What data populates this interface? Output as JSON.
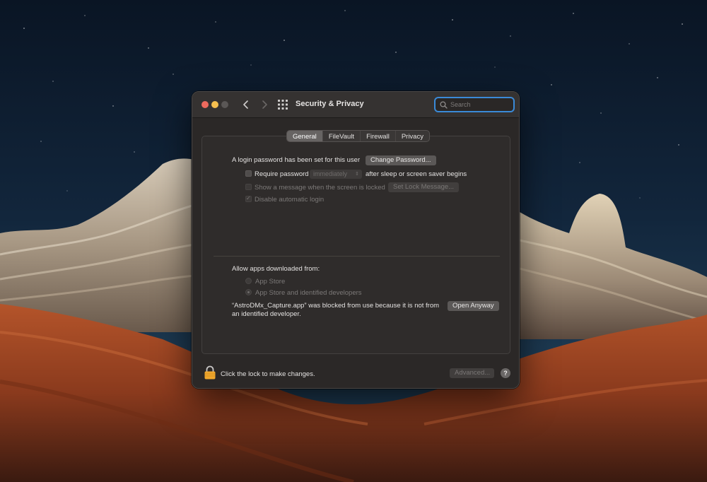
{
  "window": {
    "title": "Security & Privacy",
    "search_placeholder": "Search"
  },
  "tabs": [
    {
      "label": "General",
      "active": true
    },
    {
      "label": "FileVault",
      "active": false
    },
    {
      "label": "Firewall",
      "active": false
    },
    {
      "label": "Privacy",
      "active": false
    }
  ],
  "general": {
    "login_password_text": "A login password has been set for this user",
    "change_password_label": "Change Password...",
    "require_password_label": "Require password",
    "require_password_value": "immediately",
    "require_password_suffix": "after sleep or screen saver begins",
    "show_message_label": "Show a message when the screen is locked",
    "set_lock_message_label": "Set Lock Message...",
    "disable_auto_login_label": "Disable automatic login",
    "allow_apps_heading": "Allow apps downloaded from:",
    "radio_app_store": "App Store",
    "radio_identified": "App Store and identified developers",
    "blocked_line1": "“AstroDMx_Capture.app” was blocked from use because it is not from",
    "blocked_line2": "an identified developer.",
    "open_anyway_label": "Open Anyway"
  },
  "footer": {
    "lock_text": "Click the lock to make changes.",
    "advanced_label": "Advanced...",
    "help_label": "?"
  },
  "colors": {
    "accent_focus": "#3a8ad8",
    "close": "#ed6a5e",
    "minimize": "#f5bf4f",
    "lock": "#f0a72c"
  }
}
